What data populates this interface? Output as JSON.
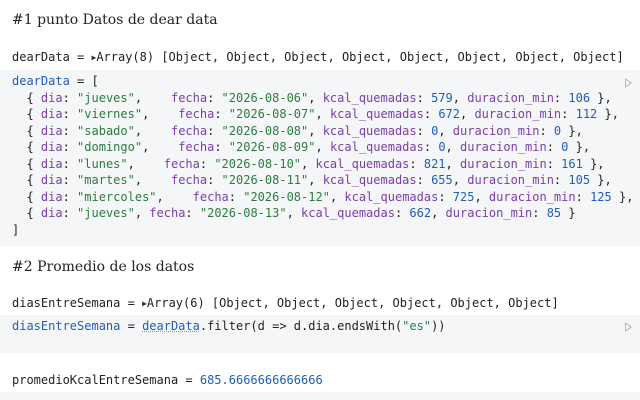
{
  "section1": {
    "heading": "#1 punto Datos de dear data",
    "output": {
      "name": "dearData",
      "eq": " = ",
      "summary": "Array(8) [Object, Object, Object, Object, Object, Object, Object, Object]"
    },
    "code": {
      "var": "dearData",
      "open": " = [",
      "rows": [
        {
          "dia": "\"jueves\"",
          "pad1": ",    ",
          "fecha": "\"2026-08-06\"",
          "kcal": "579",
          "dur": "106"
        },
        {
          "dia": "\"viernes\"",
          "pad1": ",    ",
          "fecha": "\"2026-08-07\"",
          "kcal": "672",
          "dur": "112"
        },
        {
          "dia": "\"sabado\"",
          "pad1": ",    ",
          "fecha": "\"2026-08-08\"",
          "kcal": "0",
          "dur": "0"
        },
        {
          "dia": "\"domingo\"",
          "pad1": ",    ",
          "fecha": "\"2026-08-09\"",
          "kcal": "0",
          "dur": "0"
        },
        {
          "dia": "\"lunes\"",
          "pad1": ",    ",
          "fecha": "\"2026-08-10\"",
          "kcal": "821",
          "dur": "161"
        },
        {
          "dia": "\"martes\"",
          "pad1": ",    ",
          "fecha": "\"2026-08-11\"",
          "kcal": "655",
          "dur": "105"
        },
        {
          "dia": "\"miercoles\"",
          "pad1": ",    ",
          "fecha": "\"2026-08-12\"",
          "kcal": "725",
          "dur": "125"
        },
        {
          "dia": "\"jueves\"",
          "pad1": ", ",
          "fecha": "\"2026-08-13\"",
          "kcal": "662",
          "dur": "85"
        }
      ],
      "close": "]"
    }
  },
  "section2": {
    "heading": "#2 Promedio de los datos",
    "output": {
      "name": "diasEntreSemana",
      "eq": " = ",
      "summary": "Array(6) [Object, Object, Object, Object, Object, Object]"
    },
    "code": {
      "var": "diasEntreSemana",
      "eq": " = ",
      "ref": "dearData",
      "call": ".filter(d => d.dia.endsWith(",
      "arg": "\"es\"",
      "end": "))"
    }
  },
  "section3": {
    "output": {
      "name": "promedioKcalEntreSemana",
      "eq": " = ",
      "value": "685.6666666666666"
    }
  },
  "colors": {
    "cell_bg": "#f5f6f8",
    "variable": "#1f5fb4",
    "string": "#2a7d3e",
    "key": "#7b3fa8"
  },
  "icons": [
    "play-icon",
    "disclosure-triangle-icon"
  ]
}
